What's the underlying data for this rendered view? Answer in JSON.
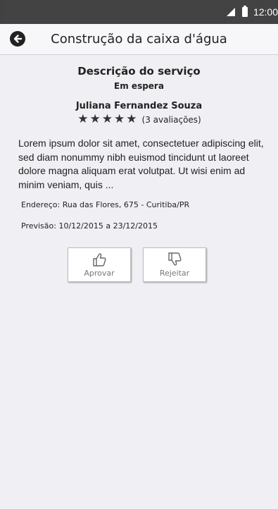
{
  "status_bar": {
    "time": "12:00",
    "icons": [
      "signal-icon",
      "battery-icon"
    ]
  },
  "app_bar": {
    "title": "Construção da caixa d'água",
    "back_icon": "back-arrow-icon"
  },
  "service": {
    "section_title": "Descrição do serviço",
    "status": "Em espera",
    "provider": "Juliana Fernandez Souza",
    "rating": {
      "stars": 5,
      "count_label": "(3 avaliações)"
    },
    "description": "Lorem ipsum dolor sit amet, consectetuer adipiscing elit, sed diam nonummy nibh euismod tincidunt ut laoreet dolore magna aliquam erat volutpat. Ut wisi enim ad minim veniam, quis ...",
    "address": "Endereço: Rua das Flores, 675 - Curitiba/PR",
    "forecast": "Previsão: 10/12/2015 a 23/12/2015"
  },
  "actions": {
    "approve_label": "Aprovar",
    "approve_icon": "thumbs-up-icon",
    "reject_label": "Rejeitar",
    "reject_icon": "thumbs-down-icon"
  }
}
